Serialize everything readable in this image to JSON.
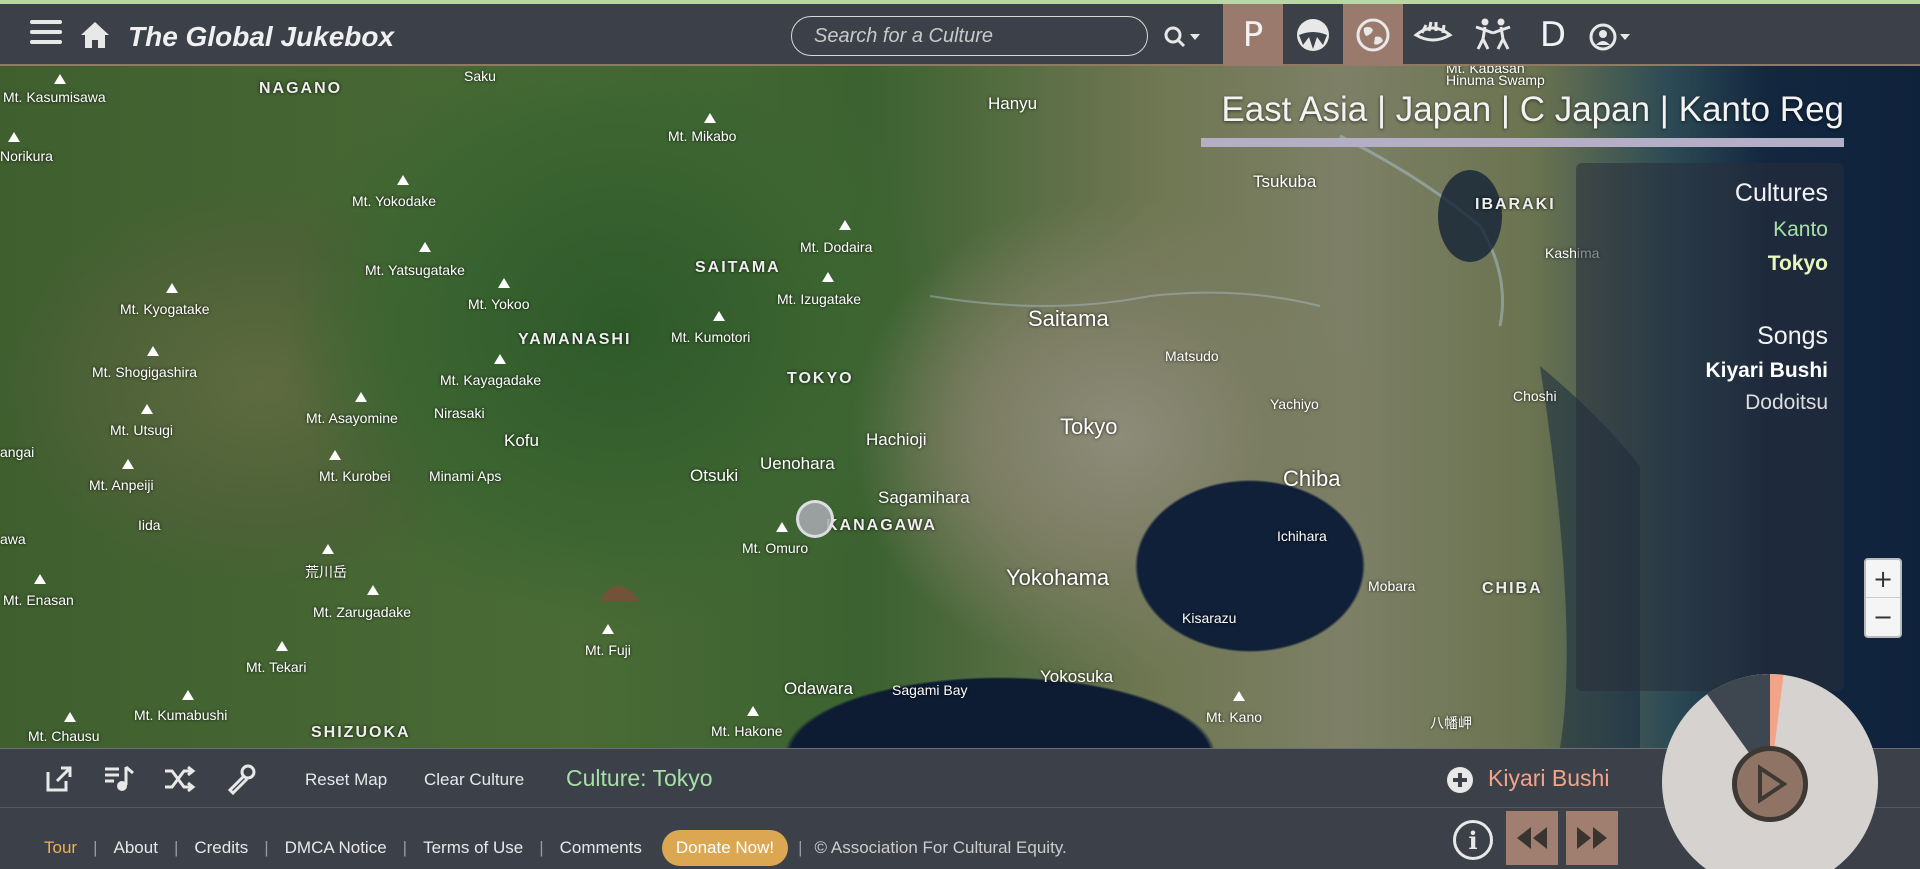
{
  "header": {
    "title": "The Global Jukebox",
    "search_placeholder": "Search for a Culture",
    "mode_letters": [
      "P",
      "D"
    ]
  },
  "map": {
    "breadcrumb": "East Asia | Japan | C Japan | Kanto Reg",
    "place_labels": [
      "NAGANO",
      "Saku",
      "Mt. Kasumisawa",
      "Hanyu",
      "Hinuma Swamp",
      "Mt. Kabasan",
      "Norikura",
      "Mt. Mikabo",
      "Mt. Yokodake",
      "Tsukuba",
      "IBARAKI",
      "Kashima",
      "Mt. Yatsugatake",
      "SAITAMA",
      "Mt. Dodaira",
      "Mt. Izugatake",
      "Mt. Yokoo",
      "Mt. Kyogatake",
      "YAMANASHI",
      "Mt. Kumotori",
      "Saitama",
      "Matsudo",
      "Mt. Shogigashira",
      "Mt. Kayagadake",
      "TOKYO",
      "Yachiyo",
      "Choshi",
      "Mt. Asayomine",
      "Nirasaki",
      "Tokyo",
      "Mt. Utsugi",
      "Kofu",
      "Hachioji",
      "angai",
      "Uenohara",
      "Mt. Kurobei",
      "Minami Aps",
      "Otsuki",
      "Chiba",
      "Mt. Anpeiji",
      "Sagamihara",
      "Iida",
      "KANAGAWA",
      "Ichihara",
      "awa",
      "Mt. Omuro",
      "荒川岳",
      "Yokohama",
      "Mobara",
      "CHIBA",
      "Mt. Enasan",
      "Mt. Zarugadake",
      "Kisarazu",
      "Mt. Fuji",
      "Mt. Tekari",
      "Yokosuka",
      "Odawara",
      "Sagami Bay",
      "Mt. Kumabushi",
      "Mt. Kano",
      "八幡岬",
      "Mt. Hakone",
      "Mt. Chausu",
      "SHIZUOKA"
    ],
    "zoom_in": "+",
    "zoom_out": "−"
  },
  "panel": {
    "cultures_heading": "Cultures",
    "cultures": [
      "Kanto",
      "Tokyo"
    ],
    "songs_heading": "Songs",
    "songs": [
      "Kiyari Bushi",
      "Dodoitsu"
    ]
  },
  "player": {
    "reset_map": "Reset Map",
    "clear_culture": "Clear Culture",
    "culture_status": "Culture: Tokyo",
    "now_playing": "Kiyari Bushi",
    "progress": 0.02
  },
  "footer": {
    "links": [
      "Tour",
      "About",
      "Credits",
      "DMCA Notice",
      "Terms of Use",
      "Comments"
    ],
    "donate": "Donate Now!",
    "copyright": "© Association For Cultural Equity.",
    "info": "i"
  },
  "colors": {
    "topbar_bg": "#3b4049",
    "accent_salmon": "#f3a488",
    "accent_green": "#a6e0a6",
    "tour_orange": "#f0b04f",
    "donate_gold": "#dba753",
    "mode_active": "#9a7a6c",
    "breadcrumb_underline": "#b4afc6"
  },
  "icons": {
    "menu": "hamburger-icon",
    "home": "home-icon",
    "search": "search-icon",
    "modes": [
      "p-mode-icon",
      "map-view-icon",
      "globe-icon",
      "hand-icon",
      "dancers-icon",
      "d-mode-icon"
    ],
    "user": "user-icon",
    "player_tools": [
      "popout-icon",
      "playlist-icon",
      "shuffle-icon",
      "microphone-icon"
    ],
    "add": "plus-circle-icon",
    "nav": [
      "rewind-icon",
      "fast-forward-icon"
    ],
    "play": "play-icon"
  }
}
